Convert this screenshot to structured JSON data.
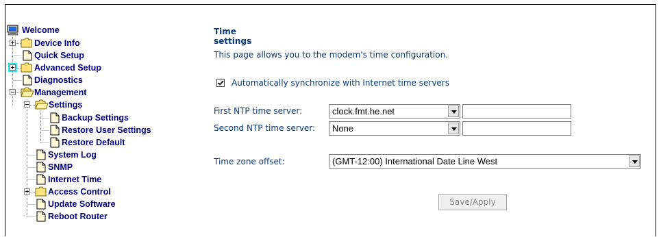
{
  "tree": {
    "welcome": "Welcome",
    "device_info": "Device Info",
    "quick_setup": "Quick Setup",
    "advanced_setup": "Advanced Setup",
    "diagnostics": "Diagnostics",
    "management": "Management",
    "settings": "Settings",
    "backup_settings": "Backup Settings",
    "restore_user_settings": "Restore User Settings",
    "restore_default": "Restore Default",
    "system_log": "System Log",
    "snmp": "SNMP",
    "internet_time": "Internet Time",
    "access_control": "Access Control",
    "update_software": "Update Software",
    "reboot_router": "Reboot Router"
  },
  "page": {
    "title": "Time settings",
    "description": "This page allows you to the modem's time configuration.",
    "auto_sync_label": "Automatically synchronize with Internet time servers",
    "auto_sync_checked": true,
    "first_ntp_label": "First NTP time server:",
    "first_ntp_value": "clock.fmt.he.net",
    "first_ntp_other": "",
    "second_ntp_label": "Second NTP time server:",
    "second_ntp_value": "None",
    "second_ntp_other": "",
    "tz_label": "Time zone offset:",
    "tz_value": "(GMT-12:00) International Date Line West",
    "save_label": "Save/Apply"
  }
}
